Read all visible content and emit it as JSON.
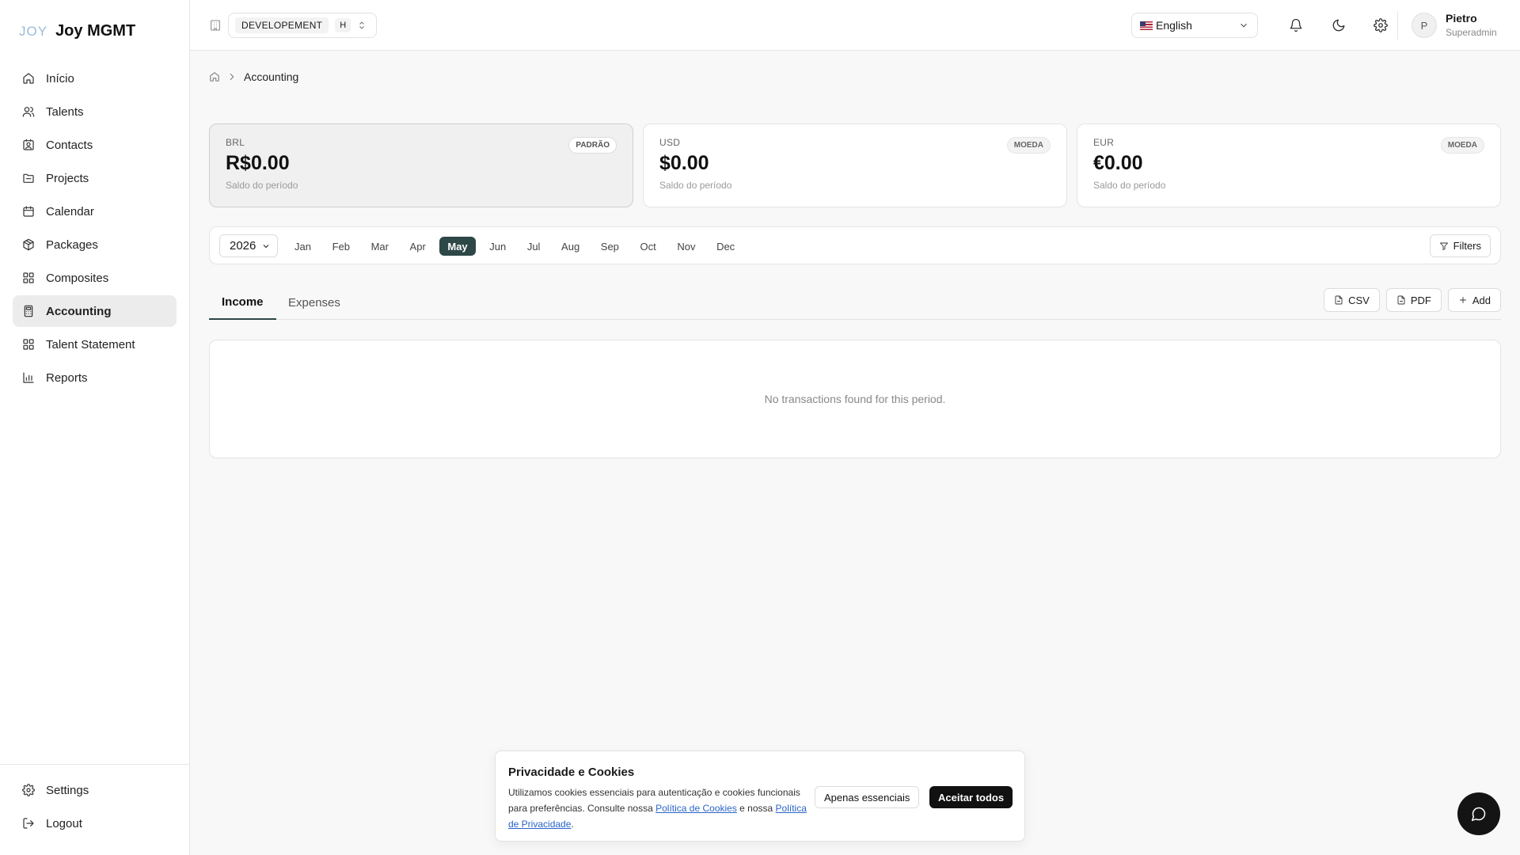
{
  "brand": {
    "logo": "JOY",
    "name": "Joy MGMT"
  },
  "sidebar": {
    "items": [
      {
        "label": "Início",
        "icon": "home-icon"
      },
      {
        "label": "Talents",
        "icon": "users-icon"
      },
      {
        "label": "Contacts",
        "icon": "contact-card-icon"
      },
      {
        "label": "Projects",
        "icon": "folder-icon"
      },
      {
        "label": "Calendar",
        "icon": "calendar-icon"
      },
      {
        "label": "Packages",
        "icon": "package-icon"
      },
      {
        "label": "Composites",
        "icon": "grid-icon"
      },
      {
        "label": "Accounting",
        "icon": "calculator-icon",
        "active": true
      },
      {
        "label": "Talent Statement",
        "icon": "grid-icon"
      },
      {
        "label": "Reports",
        "icon": "bar-chart-icon"
      }
    ],
    "bottom": [
      {
        "label": "Settings",
        "icon": "gear-icon"
      },
      {
        "label": "Logout",
        "icon": "logout-icon"
      }
    ]
  },
  "header": {
    "environment": "DEVELOPEMENT",
    "environment_short": "H",
    "language": "English",
    "user": {
      "initial": "P",
      "name": "Pietro",
      "role": "Superadmin"
    }
  },
  "breadcrumb": {
    "current": "Accounting"
  },
  "balances": [
    {
      "code": "BRL",
      "amount": "R$0.00",
      "subtitle": "Saldo do período",
      "badge": "PADRÃO",
      "active": true
    },
    {
      "code": "USD",
      "amount": "$0.00",
      "subtitle": "Saldo do período",
      "badge": "MOEDA"
    },
    {
      "code": "EUR",
      "amount": "€0.00",
      "subtitle": "Saldo do período",
      "badge": "MOEDA"
    }
  ],
  "period": {
    "year": "2026",
    "months": [
      "Jan",
      "Feb",
      "Mar",
      "Apr",
      "May",
      "Jun",
      "Jul",
      "Aug",
      "Sep",
      "Oct",
      "Nov",
      "Dec"
    ],
    "selected_month": "May",
    "filters_label": "Filters"
  },
  "tabs": {
    "income": "Income",
    "expenses": "Expenses",
    "active": "Income"
  },
  "actions": {
    "csv": "CSV",
    "pdf": "PDF",
    "add": "Add"
  },
  "empty_state": "No transactions found for this period.",
  "cookie": {
    "title": "Privacidade e Cookies",
    "text_1": "Utilizamos cookies essenciais para autenticação e cookies funcionais para preferências. Consulte nossa ",
    "link_1": "Política de Cookies",
    "text_2": " e nossa ",
    "link_2": "Política de Privacidade",
    "text_3": ".",
    "essential_label": "Apenas essenciais",
    "accept_label": "Aceitar todos"
  },
  "colors": {
    "accent": "#2e4747",
    "link": "#2a64c8",
    "dark": "#111111"
  }
}
